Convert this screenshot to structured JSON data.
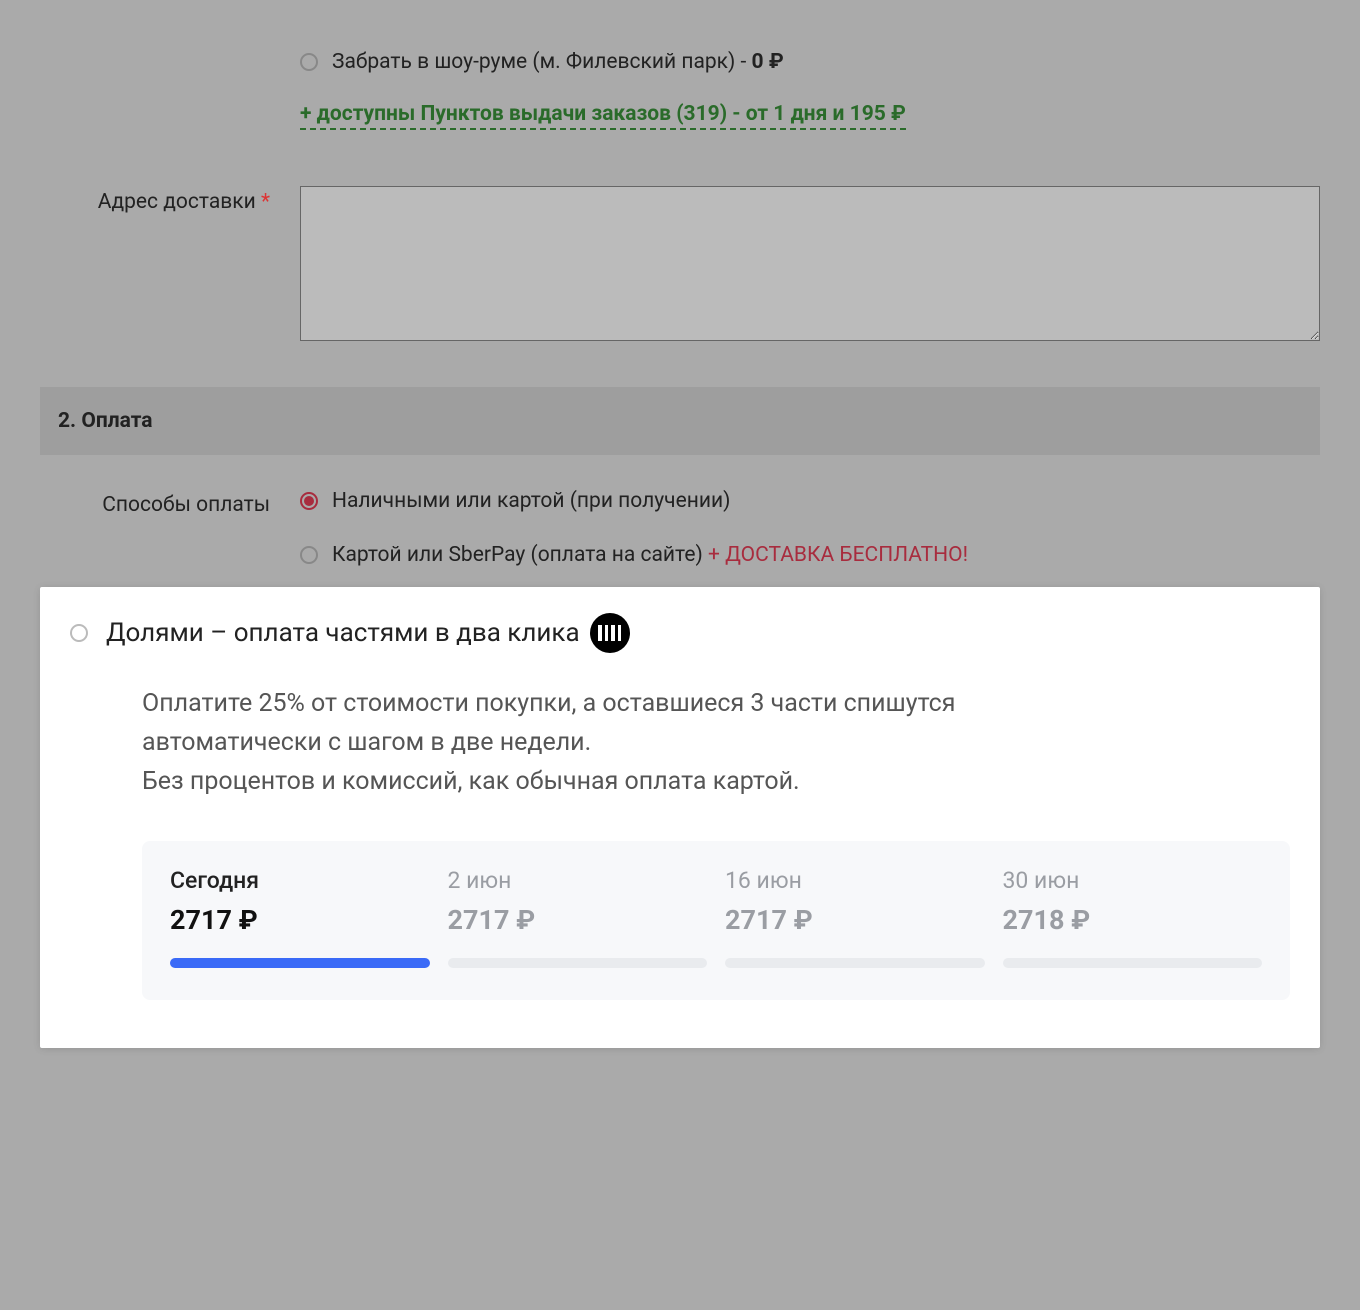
{
  "delivery": {
    "showroom_option": {
      "label_prefix": "Забрать в шоу-руме (м. Филевский парк) - ",
      "price": "0 ₽"
    },
    "pickup_points_link": "+ доступны Пунктов выдачи заказов (319) - от 1 дня и 195 ₽",
    "address_label": "Адрес доставки"
  },
  "payment": {
    "section_title": "2. Оплата",
    "methods_label": "Способы оплаты",
    "cash_label": "Наличными или картой (при получении)",
    "card_label": "Картой или SberPay (оплата на сайте) ",
    "card_promo": "+ ДОСТАВКА БЕСПЛАТНО!"
  },
  "dolyame": {
    "title": "Долями – оплата частями в два клика",
    "desc_line1": "Оплатите 25% от стоимости покупки, а оставшиеся 3 части спишутся автоматически с шагом в две недели.",
    "desc_line2": "Без процентов и комиссий, как обычная оплата картой.",
    "schedule": [
      {
        "date": "Сегодня",
        "amount": "2717 ₽",
        "active": true
      },
      {
        "date": "2 июн",
        "amount": "2717 ₽",
        "active": false
      },
      {
        "date": "16 июн",
        "amount": "2717 ₽",
        "active": false
      },
      {
        "date": "30 июн",
        "amount": "2718 ₽",
        "active": false
      }
    ]
  }
}
